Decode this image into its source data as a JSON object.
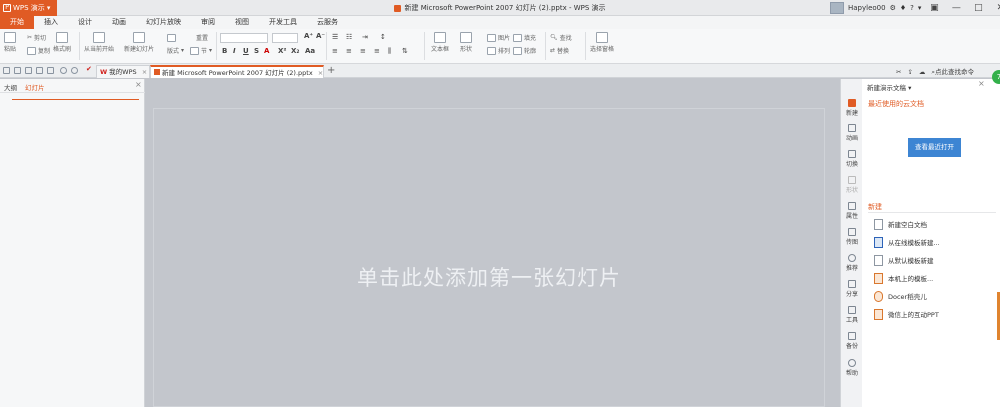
{
  "app": {
    "name": "WPS 演示",
    "logo_glyph": "P"
  },
  "window": {
    "title": "新建 Microsoft PowerPoint 2007 幻灯片 (2).pptx - WPS 演示"
  },
  "user": {
    "name": "Hapyleo00"
  },
  "window_controls": {
    "minimize": "—",
    "maximize": "□",
    "close": "✕"
  },
  "ribbon_tabs": [
    "开始",
    "插入",
    "设计",
    "动画",
    "幻灯片放映",
    "审阅",
    "视图",
    "开发工具",
    "云服务"
  ],
  "ribbon": {
    "paste": "粘贴",
    "cut": "剪切",
    "copy": "复制",
    "format_painter": "格式刷",
    "from_current": "从当前开始",
    "new_slide": "新建幻灯片",
    "layout": "版式",
    "reset": "重置",
    "section": "节",
    "textbox": "文本框",
    "shape": "形状",
    "picture": "图片",
    "fill": "填充",
    "arrange": "排列",
    "outline": "轮廓",
    "find": "查找",
    "replace": "替换",
    "select_pane": "选择窗格"
  },
  "doc_tabs": [
    {
      "label": "我的WPS",
      "close": "×"
    },
    {
      "label": "新建 Microsoft PowerPoint 2007 幻灯片 (2).pptx",
      "close": "×"
    }
  ],
  "doc_tabs_right": {
    "search": "点此查找命令"
  },
  "left_pane": {
    "tab_outline": "大纲",
    "tab_slides": "幻灯片",
    "close": "×"
  },
  "slide": {
    "placeholder": "单击此处添加第一张幻灯片"
  },
  "right_strip": [
    {
      "label": "新建",
      "state": "active"
    },
    {
      "label": "动画",
      "state": "normal"
    },
    {
      "label": "切换",
      "state": "normal"
    },
    {
      "label": "形状",
      "state": "dim"
    },
    {
      "label": "属性",
      "state": "normal"
    },
    {
      "label": "传图",
      "state": "normal"
    },
    {
      "label": "推荐",
      "state": "normal"
    },
    {
      "label": "分享",
      "state": "normal"
    },
    {
      "label": "工具",
      "state": "normal"
    },
    {
      "label": "备份",
      "state": "normal"
    },
    {
      "label": "帮助",
      "state": "normal"
    }
  ],
  "right_panel": {
    "title": "新建演示文稿 ▾",
    "close": "×",
    "recent_title": "最近使用的云文档",
    "view_recent_button": "查看最近打开",
    "new_title": "新建",
    "items": [
      "新建空白文档",
      "从在线模板新建...",
      "从默认模板新建",
      "本机上的模板...",
      "Docer稻壳儿",
      "微信上的互动PPT"
    ]
  },
  "badge": {
    "text": "7"
  }
}
